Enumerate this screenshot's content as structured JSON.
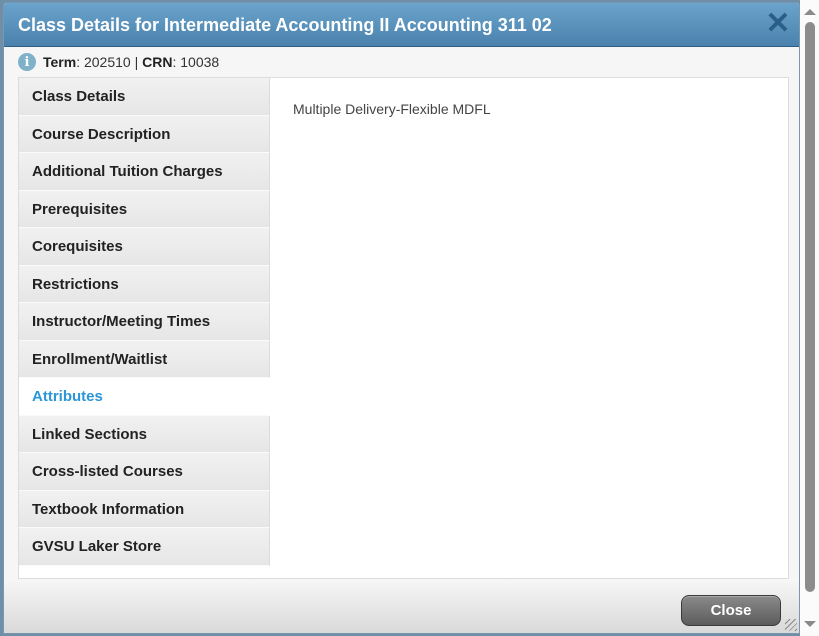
{
  "dialog": {
    "title": "Class Details for Intermediate Accounting II Accounting 311 02",
    "close_icon": "close-x-icon",
    "info": {
      "icon": "info-icon",
      "term_label": "Term",
      "term_value": "202510",
      "separator": "|",
      "crn_label": "CRN",
      "crn_value": "10038"
    },
    "tabs": [
      {
        "label": "Class Details",
        "active": false
      },
      {
        "label": "Course Description",
        "active": false
      },
      {
        "label": "Additional Tuition Charges",
        "active": false
      },
      {
        "label": "Prerequisites",
        "active": false
      },
      {
        "label": "Corequisites",
        "active": false
      },
      {
        "label": "Restrictions",
        "active": false
      },
      {
        "label": "Instructor/Meeting Times",
        "active": false
      },
      {
        "label": "Enrollment/Waitlist",
        "active": false
      },
      {
        "label": "Attributes",
        "active": true
      },
      {
        "label": "Linked Sections",
        "active": false
      },
      {
        "label": "Cross-listed Courses",
        "active": false
      },
      {
        "label": "Textbook Information",
        "active": false
      },
      {
        "label": "GVSU Laker Store",
        "active": false
      }
    ],
    "content": {
      "attribute_text": "Multiple Delivery-Flexible MDFL"
    },
    "footer": {
      "close_label": "Close"
    }
  },
  "colors": {
    "titlebar": "#5a92bd",
    "active_tab": "#2b97d8",
    "close_button": "#6e6e6e"
  }
}
